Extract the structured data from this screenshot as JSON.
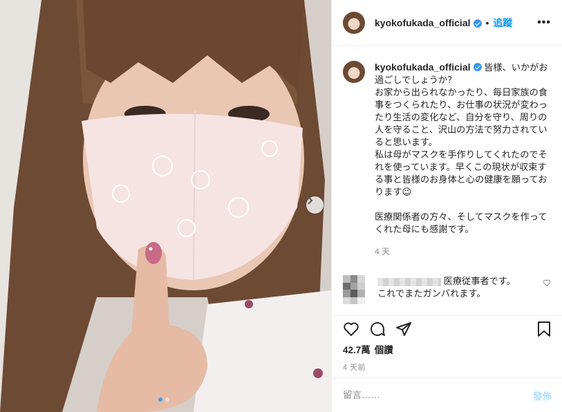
{
  "post": {
    "username": "kyokofukada_official",
    "follow_label": "追蹤",
    "separator": "•",
    "more_label": "•••"
  },
  "caption": {
    "username": "kyokofukada_official",
    "text": " 皆様、いかがお過ごしでしょうか？\nお家から出られなかったり、毎日家族の食事をつくられたり、お仕事の状況が変わったり生活の変化など、自分を守り、周りの人を守ること、沢山の方法で努力されていると思います。\n私は母がマスクを手作りしてくれたのでそれを使っています。早くこの現状が収束する事と皆様のお身体と心の健康を願っております😉\n\n医療関係者の方々、そしてマスクを作ってくれた母にも感謝です。",
    "time": "4 天"
  },
  "comment": {
    "text": "医療従事者です。\nこれでまたガンバれます。"
  },
  "stats": {
    "views_count": "42.7萬",
    "views_label": "個讚",
    "date": "4 天前"
  },
  "comment_box": {
    "placeholder": "留言……",
    "post_label": "發佈"
  },
  "carousel": {
    "count": 2,
    "active": 0
  },
  "colors": {
    "accent": "#0095f6",
    "verified": "#3897f0",
    "post_disabled": "#b2dffc"
  }
}
